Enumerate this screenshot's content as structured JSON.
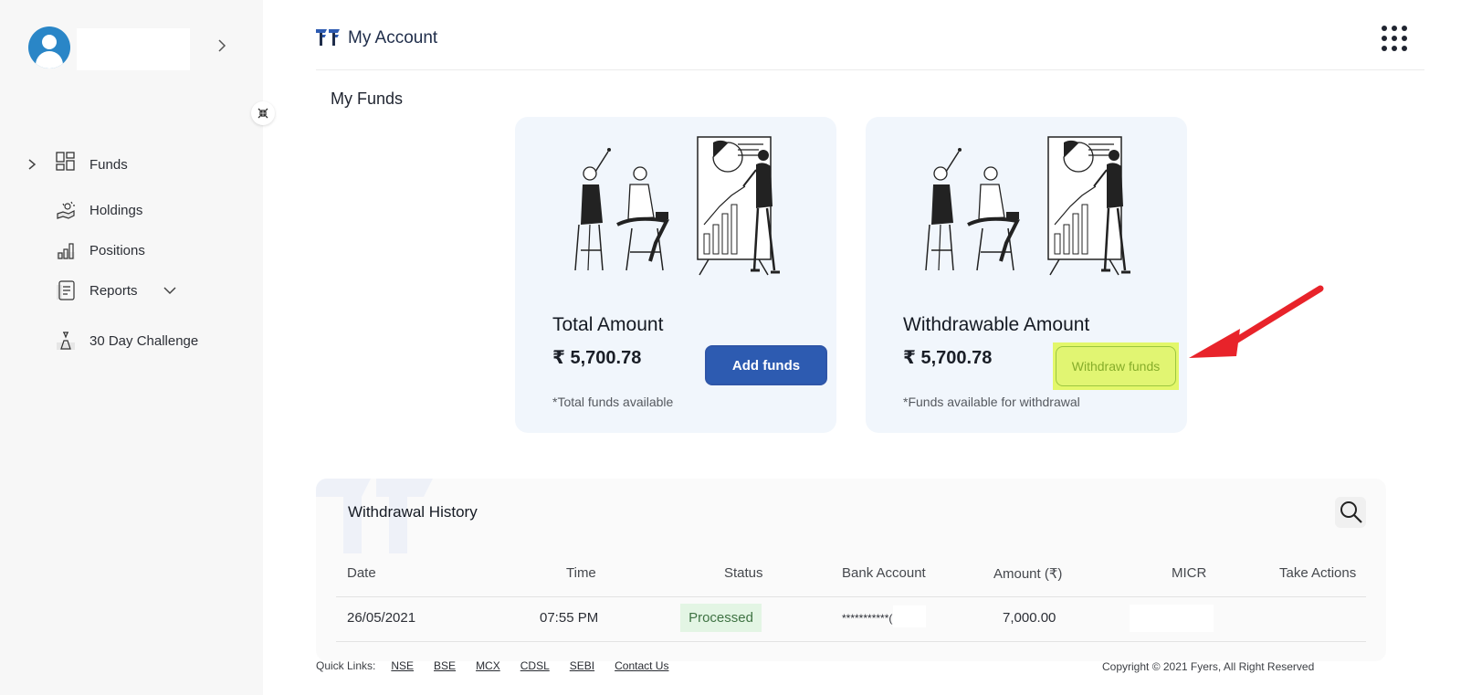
{
  "header": {
    "title": "My Account"
  },
  "sidebar": {
    "items": [
      {
        "label": "Funds",
        "icon": "funds-icon"
      },
      {
        "label": "Holdings",
        "icon": "holdings-icon"
      },
      {
        "label": "Positions",
        "icon": "positions-icon"
      },
      {
        "label": "Reports",
        "icon": "reports-icon"
      },
      {
        "label": "30 Day Challenge",
        "icon": "challenge-icon"
      }
    ]
  },
  "section": {
    "title": "My Funds"
  },
  "cards": {
    "total": {
      "label": "Total Amount",
      "amount": "₹ 5,700.78",
      "note": "*Total funds available",
      "button": "Add funds"
    },
    "withdrawable": {
      "label": "Withdrawable Amount",
      "amount": "₹ 5,700.78",
      "note": "*Funds available for withdrawal",
      "button": "Withdraw funds"
    }
  },
  "history": {
    "title": "Withdrawal History",
    "columns": [
      "Date",
      "Time",
      "Status",
      "Bank Account",
      "Amount (₹)",
      "MICR",
      "Take Actions"
    ],
    "rows": [
      {
        "date": "26/05/2021",
        "time": "07:55 PM",
        "status": "Processed",
        "bank_account": "***********(",
        "amount": "7,000.00",
        "micr": ""
      }
    ]
  },
  "footer": {
    "quick_links_label": "Quick Links:",
    "links": [
      "NSE",
      "BSE",
      "MCX",
      "CDSL",
      "SEBI",
      "Contact Us"
    ],
    "copyright": "Copyright © 2021 Fyers, All Right Reserved"
  },
  "colors": {
    "primary": "#2d5bb1",
    "highlight": "#e3f76a",
    "status_green": "#e3f5e4",
    "annotation_red": "#e8232a"
  }
}
